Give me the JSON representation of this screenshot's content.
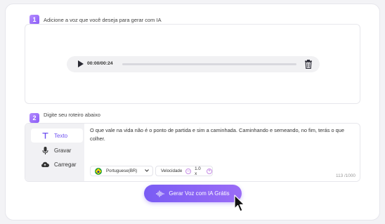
{
  "step1": {
    "number": "1",
    "label": "Adicione a voz que você deseja para gerar com IA"
  },
  "player": {
    "time": "00:00/00:24",
    "play_icon": "play-icon",
    "trash_icon": "trash-icon"
  },
  "step2": {
    "number": "2",
    "label": "Digite seu roteiro abaixo"
  },
  "tabs": [
    {
      "label": "Texto",
      "icon": "text-icon",
      "active": true
    },
    {
      "label": "Gravar",
      "icon": "microphone-icon",
      "active": false
    },
    {
      "label": "Carregar",
      "icon": "cloud-upload-icon",
      "active": false
    }
  ],
  "script": {
    "text": "O que vale na vida não é o ponto de partida e sim a caminhada. Caminhando e semeando, no fim, terás o que colher."
  },
  "language": {
    "value": "Portuguese(BR)",
    "icon": "brazil-flag-icon"
  },
  "speed": {
    "label": "Velocidade",
    "value": "1.0 x"
  },
  "counter": "113 /1000",
  "generate_button": {
    "label": "Gerar Voz com IA Grátis",
    "icon": "waveform-icon"
  },
  "colors": {
    "accent": "#7a5cf4",
    "badge": "#a678ff"
  }
}
